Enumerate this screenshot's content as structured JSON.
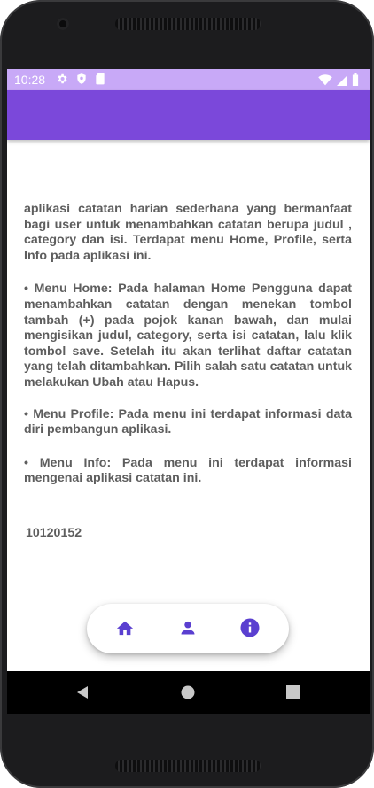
{
  "status_bar": {
    "time": "10:28",
    "left_icons": [
      "gear-icon",
      "shield-icon",
      "sim-card-icon"
    ],
    "right_icons": [
      "wifi-icon",
      "signal-icon",
      "battery-icon"
    ]
  },
  "app_bar": {
    "color": "#7b48da"
  },
  "content": {
    "intro": "aplikasi catatan harian sederhana yang bermanfaat bagi user untuk menambahkan catatan berupa judul , category dan isi. Terdapat menu Home, Profile, serta Info pada aplikasi ini.",
    "menu_home": "• Menu Home: Pada halaman Home Pengguna dapat menambahkan catatan dengan menekan tombol tambah (+) pada pojok kanan bawah, dan mulai mengisikan judul, category, serta isi catatan, lalu klik tombol save. Setelah itu akan terlihat daftar catatan yang telah ditambahkan. Pilih salah satu catatan untuk melakukan Ubah atau Hapus.",
    "menu_profile": "• Menu Profile: Pada menu ini terdapat informasi data diri pembangun aplikasi.",
    "menu_info": "• Menu Info: Pada menu ini terdapat informasi mengenai aplikasi catatan ini.",
    "nim": "10120152"
  },
  "bottom_nav": {
    "items": [
      {
        "icon": "home-icon"
      },
      {
        "icon": "person-icon"
      },
      {
        "icon": "info-icon",
        "selected": true
      }
    ],
    "icon_color": "#5a3fd0"
  },
  "system_nav": {
    "keys": [
      "back-icon",
      "home-circle-icon",
      "recents-icon"
    ]
  }
}
